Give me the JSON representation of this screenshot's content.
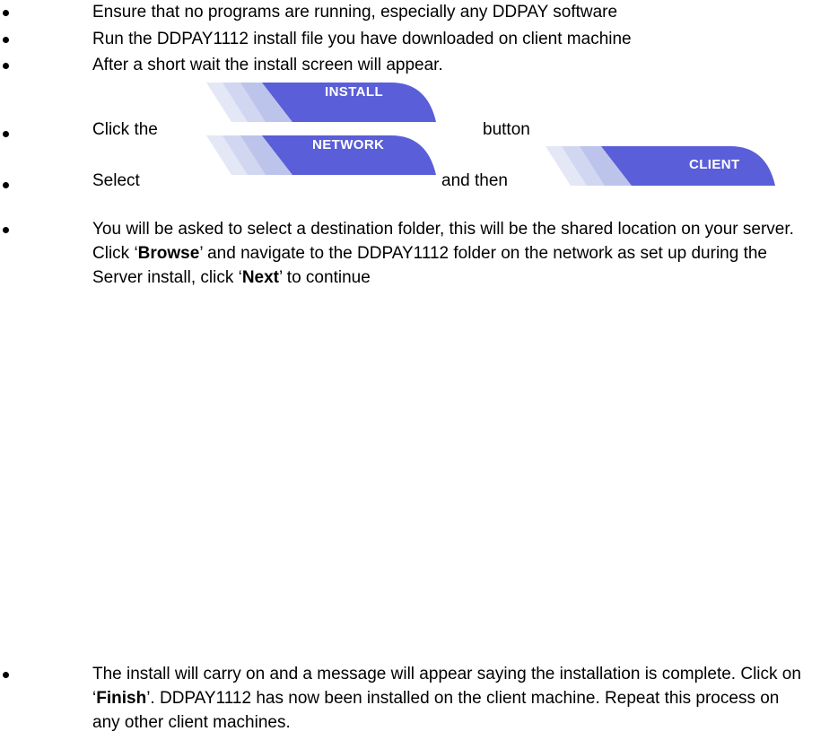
{
  "steps": [
    "Ensure that no programs are running, especially any DDPAY software",
    "Run the DDPAY1112 install file you have downloaded on client machine",
    "After a short wait the install screen will appear."
  ],
  "click_step": {
    "prefix": "Click the",
    "button_label": "INSTALL",
    "suffix": "button"
  },
  "select_step": {
    "prefix": "Select",
    "network_label": "NETWORK",
    "middle": "and then",
    "client_label": "CLIENT"
  },
  "destination_step": {
    "t1": "You will be asked to select a destination folder, this will be the shared location on your server. Click ‘",
    "browse": "Browse",
    "t2": "’ and navigate to the DDPAY1112 folder on the network as set up during the Server install, click ‘",
    "next": "Next",
    "t3": "’ to continue"
  },
  "finish_step": {
    "t1": "The install will carry on and a message will appear saying the installation is complete. Click on ‘",
    "finish": "Finish",
    "t2": "’. DDPAY1112 has now been installed on the client machine. Repeat this process on any other client machines."
  },
  "colors": {
    "button_fill": "#5a5ed8",
    "button_fade": "#c9d0ef"
  }
}
